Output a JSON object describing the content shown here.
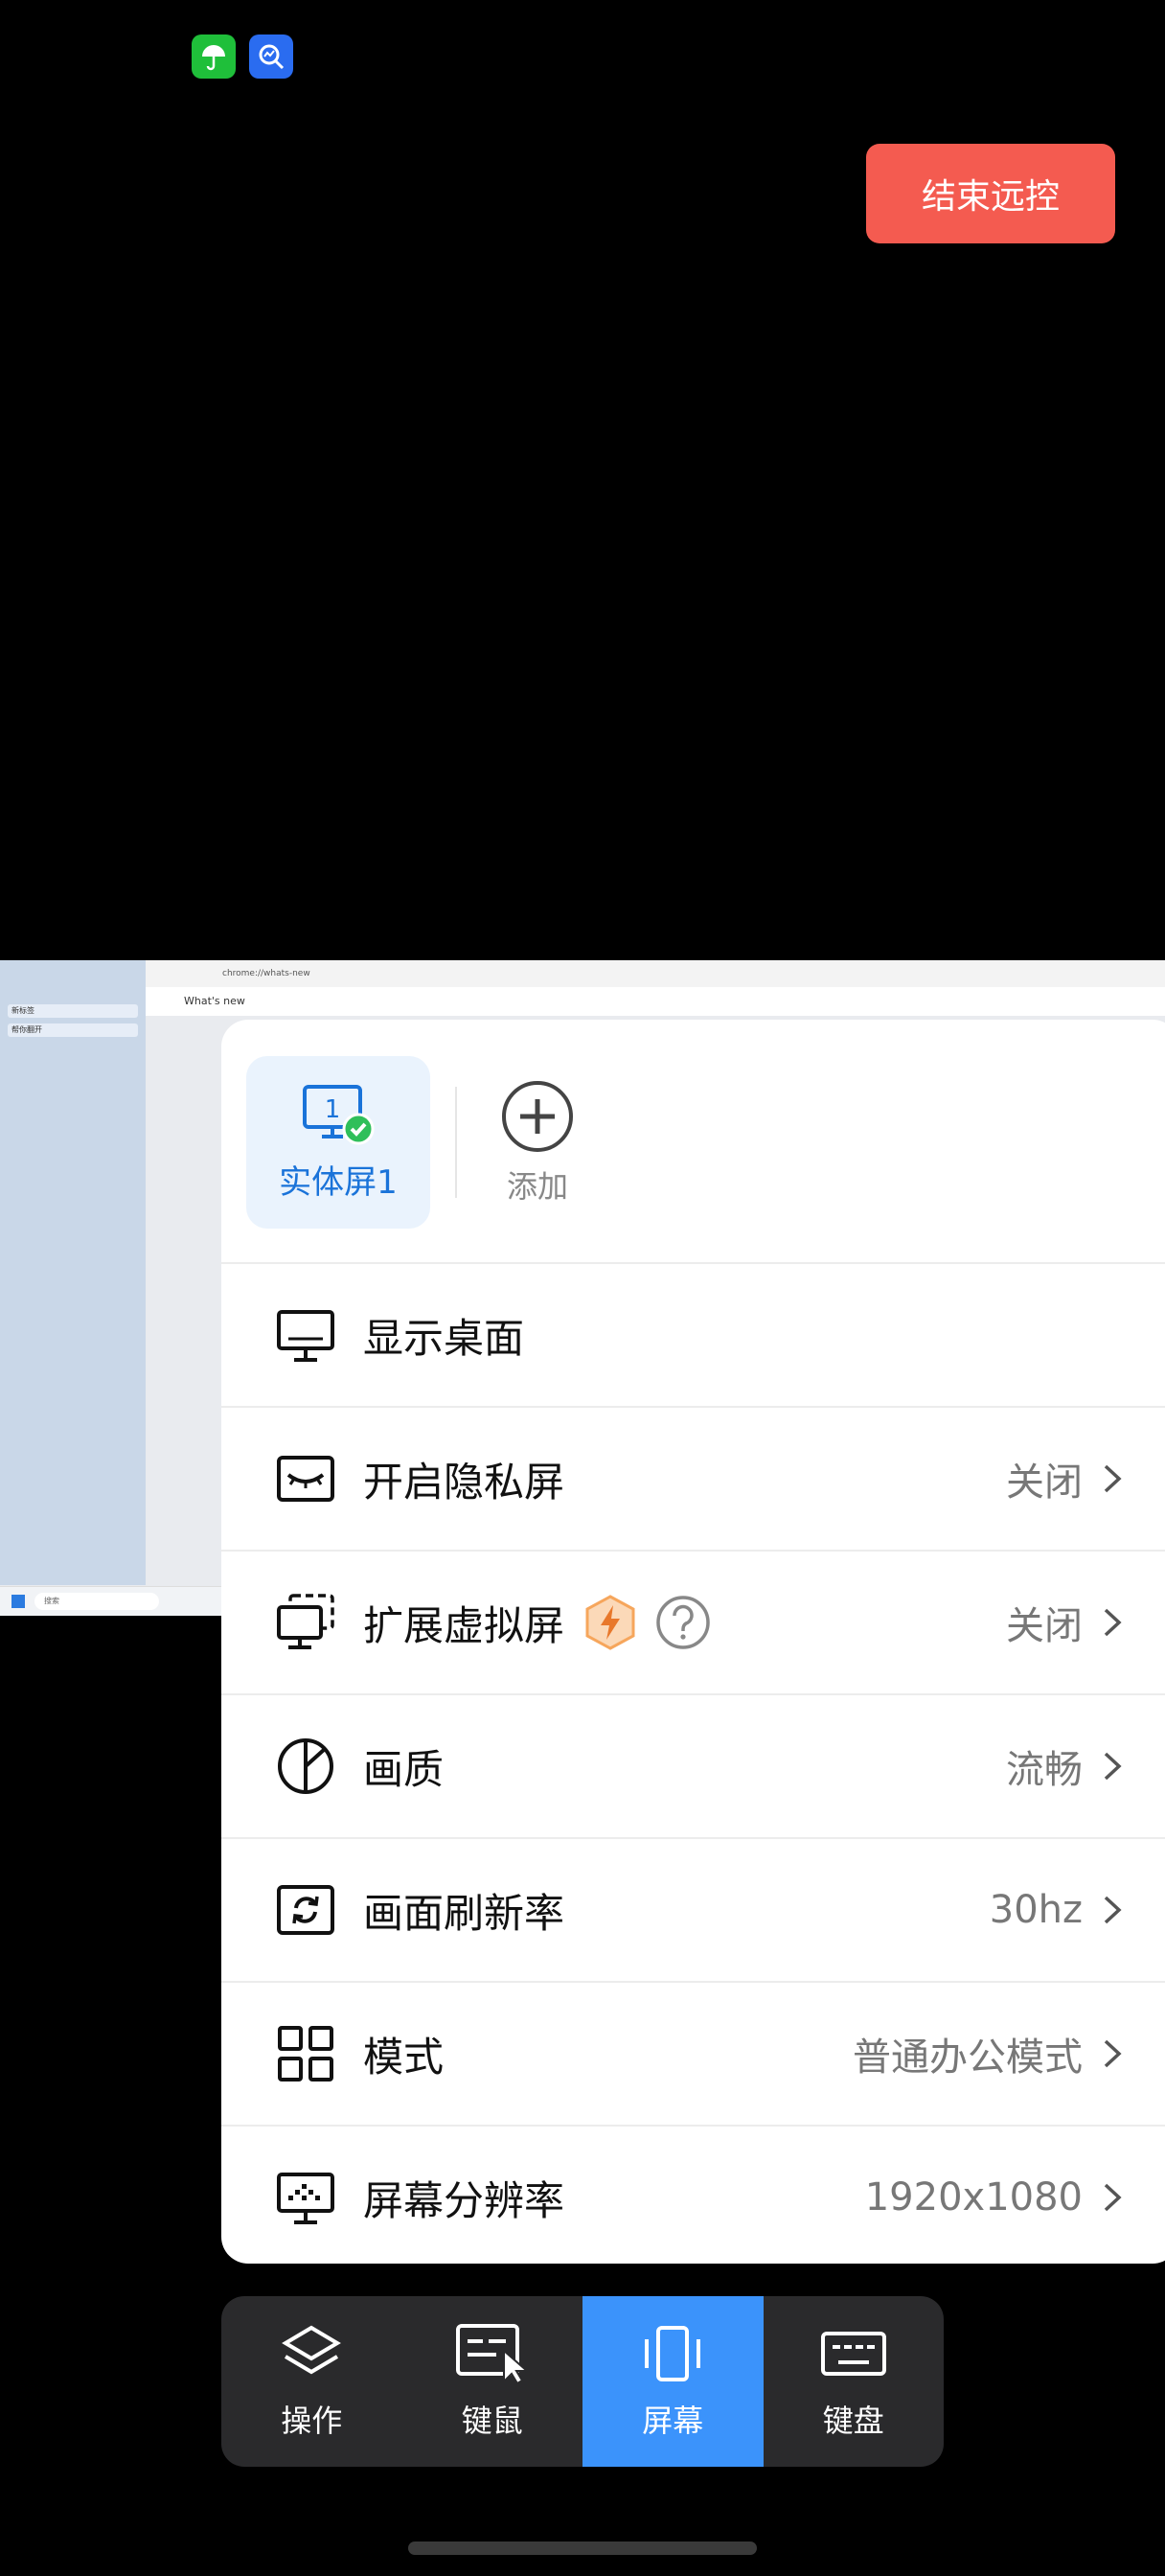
{
  "status_bar": {
    "icons": [
      "umbrella-app-icon",
      "search-chart-app-icon"
    ]
  },
  "end_button": {
    "label": "结束远控"
  },
  "remote_desktop": {
    "browser_url": "chrome://whats-new",
    "tab_title": "What's new",
    "sidebar_tabs": [
      "新标签",
      "帮你翻开"
    ],
    "taskbar_search": "搜索"
  },
  "screens": {
    "items": [
      {
        "label": "实体屏1",
        "number": "1",
        "selected": true
      }
    ],
    "add_label": "添加"
  },
  "settings": {
    "rows": [
      {
        "title": "显示桌面",
        "value": "",
        "icon": "monitor-icon"
      },
      {
        "title": "开启隐私屏",
        "value": "关闭",
        "icon": "privacy-eye-icon"
      },
      {
        "title": "扩展虚拟屏",
        "value": "关闭",
        "icon": "virtual-screens-icon"
      },
      {
        "title": "画质",
        "value": "流畅",
        "icon": "quality-icon"
      },
      {
        "title": "画面刷新率",
        "value": "30hz",
        "icon": "refresh-rate-icon"
      },
      {
        "title": "模式",
        "value": "普通办公模式",
        "icon": "grid-mode-icon"
      },
      {
        "title": "屏幕分辨率",
        "value": "1920x1080",
        "icon": "resolution-icon"
      }
    ]
  },
  "toolbar": {
    "items": [
      {
        "label": "操作",
        "icon": "layers-icon",
        "active": false
      },
      {
        "label": "键鼠",
        "icon": "keyboard-mouse-icon",
        "active": false
      },
      {
        "label": "屏幕",
        "icon": "screen-icon",
        "active": true
      },
      {
        "label": "键盘",
        "icon": "keyboard-icon",
        "active": false
      }
    ]
  },
  "colors": {
    "accent": "#3b93fb",
    "end_button": "#f45b50",
    "selected_card": "#eaf3fd",
    "badge": "#f6a65c"
  }
}
